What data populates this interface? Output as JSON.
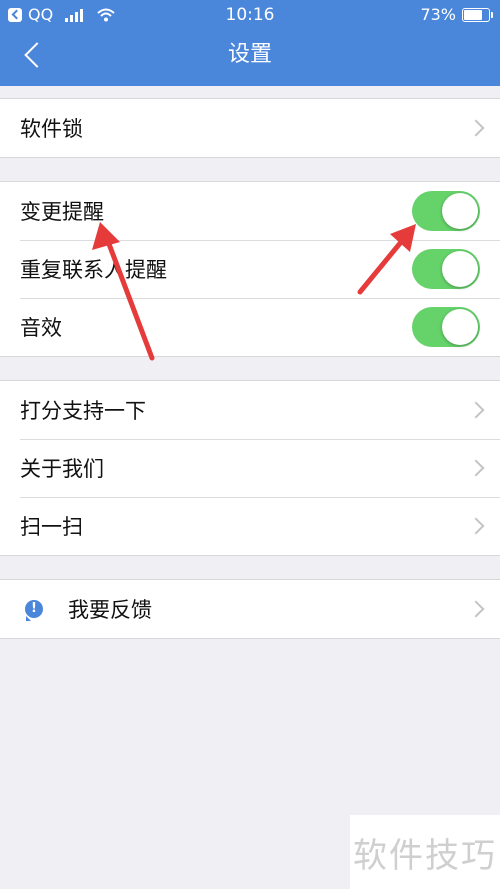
{
  "status_bar": {
    "back_app": "QQ",
    "time": "10:16",
    "battery": "73%",
    "battery_level": 0.73
  },
  "nav": {
    "title": "设置"
  },
  "groups": {
    "lock": {
      "label": "软件锁"
    },
    "notify": {
      "items": [
        {
          "label": "变更提醒",
          "on": true
        },
        {
          "label": "重复联系人提醒",
          "on": true
        },
        {
          "label": "音效",
          "on": true
        }
      ]
    },
    "misc": {
      "items": [
        {
          "label": "打分支持一下"
        },
        {
          "label": "关于我们"
        },
        {
          "label": "扫一扫"
        }
      ]
    },
    "feedback": {
      "label": "我要反馈",
      "icon": "!"
    }
  },
  "colors": {
    "accent": "#4a86d9",
    "switch_on": "#65d26a",
    "arrow": "#e53b3b"
  },
  "watermark": "软件技巧"
}
